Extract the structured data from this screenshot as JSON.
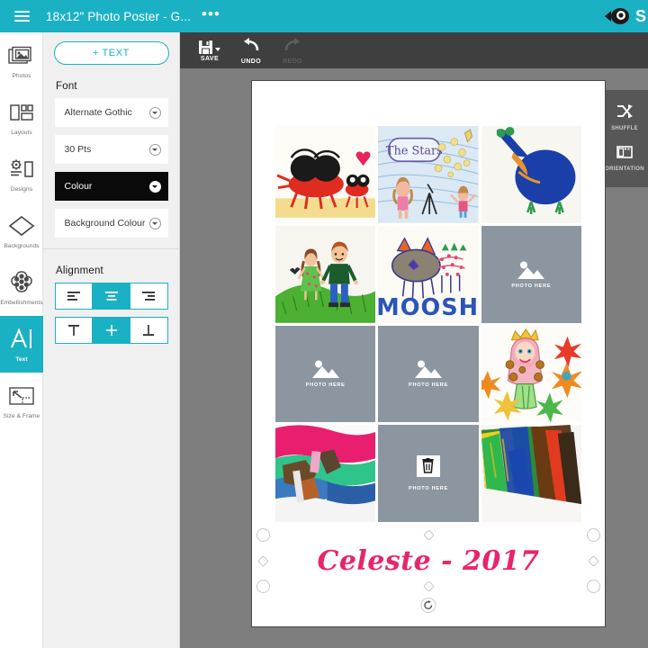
{
  "topbar": {
    "menu_icon": "hamburger-icon",
    "title": "18x12\" Photo Poster - G...",
    "overflow": "•••",
    "brand_icon": "fish-eye-logo",
    "brand_letter": "S"
  },
  "rail": {
    "items": [
      {
        "label": "Photos",
        "icon": "photos-icon",
        "active": false
      },
      {
        "label": "Layouts",
        "icon": "layouts-icon",
        "active": false
      },
      {
        "label": "Designs",
        "icon": "designs-icon",
        "active": false
      },
      {
        "label": "Backgrounds",
        "icon": "backgrounds-icon",
        "active": false
      },
      {
        "label": "Embellishments",
        "icon": "embellishments-icon",
        "active": false
      },
      {
        "label": "Text",
        "icon": "text-icon",
        "active": true
      },
      {
        "label": "Size & Frame",
        "icon": "size-frame-icon",
        "active": false
      }
    ]
  },
  "panel": {
    "add_text": "+ TEXT",
    "font_section": "Font",
    "fields": [
      {
        "label": "Alternate Gothic",
        "dark": false
      },
      {
        "label": "30 Pts",
        "dark": false
      },
      {
        "label": "Colour",
        "dark": true
      },
      {
        "label": "Background Colour",
        "dark": false
      }
    ],
    "alignment_section": "Alignment",
    "horizontal": [
      {
        "name": "align-left",
        "selected": false
      },
      {
        "name": "align-center",
        "selected": true
      },
      {
        "name": "align-right",
        "selected": false
      }
    ],
    "vertical": [
      {
        "name": "align-top",
        "selected": false
      },
      {
        "name": "align-middle",
        "selected": true
      },
      {
        "name": "align-bottom",
        "selected": false
      }
    ]
  },
  "toolbar": {
    "tools": [
      {
        "label": "SAVE",
        "icon": "save-icon",
        "disabled": false,
        "has_dropdown": true
      },
      {
        "label": "UNDO",
        "icon": "undo-icon",
        "disabled": false,
        "has_dropdown": false
      },
      {
        "label": "REDO",
        "icon": "redo-icon",
        "disabled": true,
        "has_dropdown": false
      }
    ]
  },
  "sidetools": {
    "items": [
      {
        "label": "SHUFFLE",
        "icon": "shuffle-icon"
      },
      {
        "label": "ORIENTATION",
        "icon": "orientation-icon"
      }
    ]
  },
  "canvas": {
    "placeholder_label": "PHOTO HERE",
    "cells": [
      {
        "type": "photo",
        "name": "crab-drawing",
        "caption": ""
      },
      {
        "type": "photo",
        "name": "stars-drawing",
        "caption": "The Stars"
      },
      {
        "type": "photo",
        "name": "blue-bird-drawing",
        "caption": ""
      },
      {
        "type": "photo",
        "name": "couple-hill-drawing",
        "caption": ""
      },
      {
        "type": "photo",
        "name": "moosh-cat-drawing",
        "caption": "MOOSH"
      },
      {
        "type": "placeholder",
        "name": "photo-placeholder-6",
        "caption": ""
      },
      {
        "type": "placeholder",
        "name": "photo-placeholder-7",
        "caption": ""
      },
      {
        "type": "placeholder",
        "name": "photo-placeholder-8",
        "caption": ""
      },
      {
        "type": "photo",
        "name": "princess-flowers-drawing",
        "caption": ""
      },
      {
        "type": "photo",
        "name": "pink-paint-drawing",
        "caption": ""
      },
      {
        "type": "placeholder",
        "name": "photo-placeholder-11",
        "caption": "",
        "trash": true
      },
      {
        "type": "photo",
        "name": "rainbow-paint-drawing",
        "caption": ""
      }
    ],
    "text_element": {
      "value": "Celeste - 2017",
      "colour": "#e8246c",
      "selected": true,
      "rotate_handle": "rotate-icon"
    }
  },
  "colors": {
    "accent": "#1bb1c4",
    "toolbar_bg": "#3f3f3f",
    "work_bg": "#7d7d7d",
    "panel_bg": "#f0f0f0",
    "placeholder": "#8c96a0",
    "text_pink": "#e8246c"
  }
}
